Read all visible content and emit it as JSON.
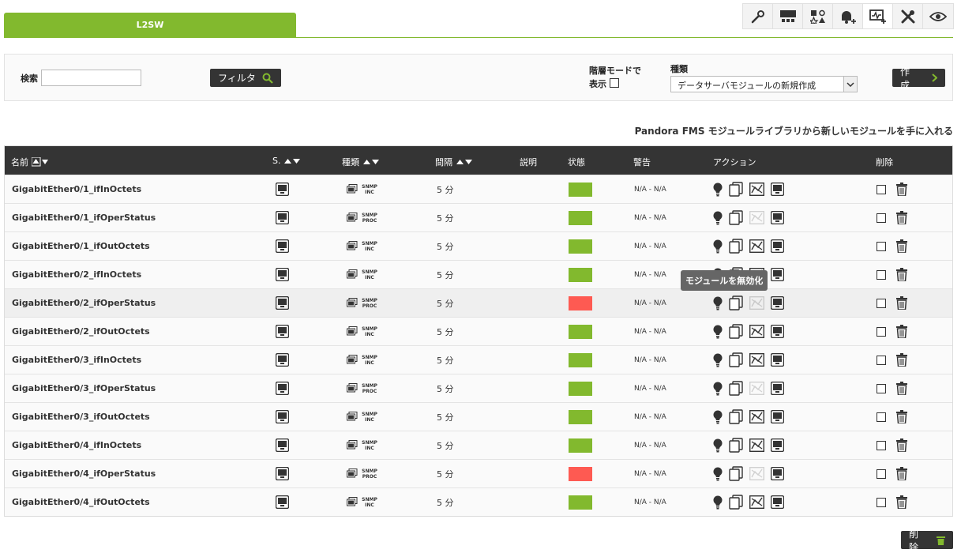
{
  "tab": {
    "label": "L2SW"
  },
  "toolbar": {
    "icons": [
      "wrench-icon",
      "network-icon",
      "modules-icon",
      "bell-plus-icon",
      "monitor-plus-icon",
      "tools-icon",
      "eye-icon"
    ],
    "active_index": 4
  },
  "filter": {
    "search_label": "検索",
    "search_value": "",
    "filter_button": "フィルタ",
    "hierarchy_label_line1": "階層モードで",
    "hierarchy_label_line2": "表示",
    "type_label": "種類",
    "type_selected": "データサーバモジュールの新規作成",
    "create_button": "作成"
  },
  "library_link": "Pandora FMS モジュールライブラリから新しいモジュールを手に入れる",
  "table": {
    "headers": {
      "name": "名前",
      "s": "S.",
      "type": "種類",
      "interval": "間隔",
      "desc": "説明",
      "status": "状態",
      "warning": "警告",
      "actions": "アクション",
      "delete": "削除"
    },
    "rows": [
      {
        "name": "GigabitEther0/1_ifInOctets",
        "type": "SNMP INC",
        "interval": "5 分",
        "status": "green",
        "warning": "N/A - N/A",
        "graph_enabled": true
      },
      {
        "name": "GigabitEther0/1_ifOperStatus",
        "type": "SNMP PROC",
        "interval": "5 分",
        "status": "green",
        "warning": "N/A - N/A",
        "graph_enabled": false
      },
      {
        "name": "GigabitEther0/1_ifOutOctets",
        "type": "SNMP INC",
        "interval": "5 分",
        "status": "green",
        "warning": "N/A - N/A",
        "graph_enabled": true
      },
      {
        "name": "GigabitEther0/2_ifInOctets",
        "type": "SNMP INC",
        "interval": "5 分",
        "status": "green",
        "warning": "N/A - N/A",
        "graph_enabled": true
      },
      {
        "name": "GigabitEther0/2_ifOperStatus",
        "type": "SNMP PROC",
        "interval": "5 分",
        "status": "red",
        "warning": "N/A - N/A",
        "graph_enabled": false
      },
      {
        "name": "GigabitEther0/2_ifOutOctets",
        "type": "SNMP INC",
        "interval": "5 分",
        "status": "green",
        "warning": "N/A - N/A",
        "graph_enabled": true
      },
      {
        "name": "GigabitEther0/3_ifInOctets",
        "type": "SNMP INC",
        "interval": "5 分",
        "status": "green",
        "warning": "N/A - N/A",
        "graph_enabled": true
      },
      {
        "name": "GigabitEther0/3_ifOperStatus",
        "type": "SNMP PROC",
        "interval": "5 分",
        "status": "green",
        "warning": "N/A - N/A",
        "graph_enabled": false
      },
      {
        "name": "GigabitEther0/3_ifOutOctets",
        "type": "SNMP INC",
        "interval": "5 分",
        "status": "green",
        "warning": "N/A - N/A",
        "graph_enabled": true
      },
      {
        "name": "GigabitEther0/4_ifInOctets",
        "type": "SNMP INC",
        "interval": "5 分",
        "status": "green",
        "warning": "N/A - N/A",
        "graph_enabled": true
      },
      {
        "name": "GigabitEther0/4_ifOperStatus",
        "type": "SNMP PROC",
        "interval": "5 分",
        "status": "red",
        "warning": "N/A - N/A",
        "graph_enabled": false
      },
      {
        "name": "GigabitEther0/4_ifOutOctets",
        "type": "SNMP INC",
        "interval": "5 分",
        "status": "green",
        "warning": "N/A - N/A",
        "graph_enabled": true
      }
    ]
  },
  "tooltip": "モジュールを無効化",
  "delete_button": "削除",
  "colors": {
    "accent": "#82b92e",
    "status_green": "#82b92e",
    "status_red": "#fe5a52",
    "dark": "#343434"
  }
}
